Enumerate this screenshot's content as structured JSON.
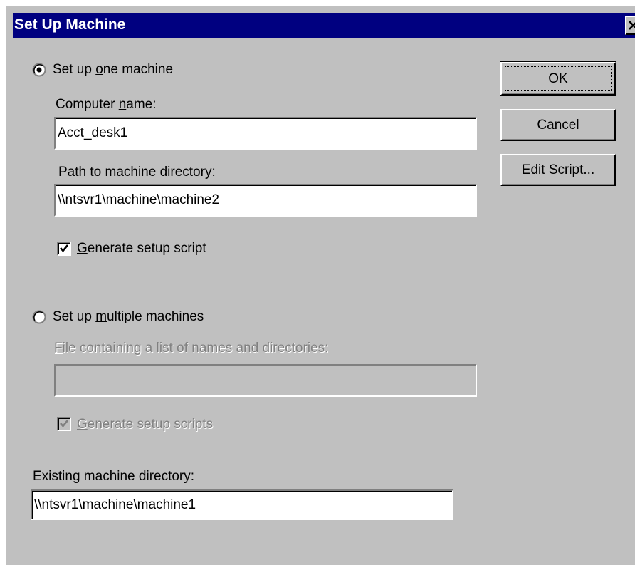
{
  "window": {
    "title": "Set Up Machine"
  },
  "buttons": {
    "ok": "OK",
    "cancel": "Cancel",
    "edit_script": {
      "mnemonic": "E",
      "rest": "dit Script..."
    }
  },
  "single": {
    "selected": true,
    "radio_label": {
      "before": "Set up ",
      "mnemonic": "o",
      "after": "ne machine"
    },
    "computer_name_label": {
      "before": "Computer ",
      "mnemonic": "n",
      "after": "ame:"
    },
    "computer_name_value": "Acct_desk1",
    "path_label": "Path to machine directory:",
    "path_value": "\\\\ntsvr1\\machine\\machine2",
    "generate_checked": true,
    "generate_label": {
      "mnemonic": "G",
      "rest": "enerate setup script"
    }
  },
  "multiple": {
    "selected": false,
    "radio_label": {
      "before": "Set up ",
      "mnemonic": "m",
      "after": "ultiple machines"
    },
    "file_label": {
      "mnemonic": "F",
      "rest": "ile containing a list of names and directories:"
    },
    "file_value": "",
    "generate_checked": true,
    "generate_label": {
      "mnemonic": "G",
      "rest": "enerate setup scripts"
    }
  },
  "existing": {
    "label": "Existing machine directory:",
    "value": "\\\\ntsvr1\\machine\\machine1"
  },
  "icons": {
    "close": "close-icon",
    "radio_on": "radio-selected-icon",
    "radio_off": "radio-unselected-icon",
    "check": "checkmark-icon"
  },
  "colors": {
    "titlebar": "#000080",
    "face": "#c0c0c0",
    "disabled_text": "#808080"
  }
}
